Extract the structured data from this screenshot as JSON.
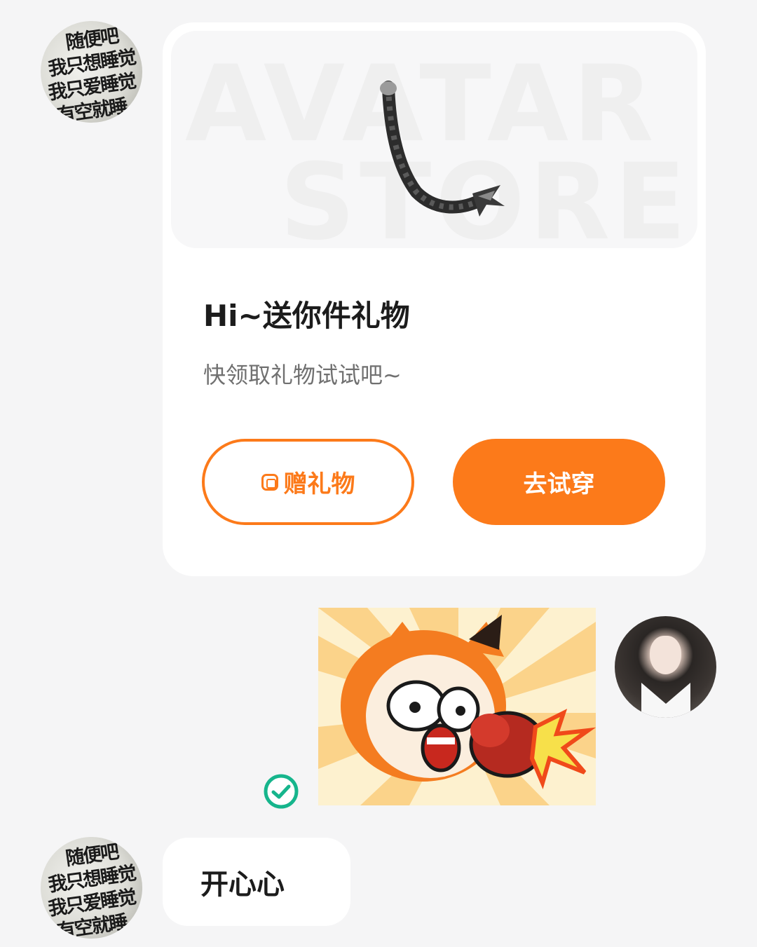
{
  "chat": {
    "gift_card": {
      "banner_background_text_line1": "AVATAR",
      "banner_background_text_line2": "STORE",
      "banner_item": "tail-accessory",
      "title": "Hi~送你件礼物",
      "subtitle": "快领取礼物试试吧~",
      "gift_button_icon": "gift-icon",
      "gift_button_label": "赠礼物",
      "try_button_label": "去试穿"
    },
    "sent_sticker": {
      "description": "orange-haired character punched by boxing glove",
      "status_icon": "check-circle-icon"
    },
    "received_text": "开心心",
    "other_avatar_text": [
      "随便吧",
      "我只想睡觉",
      "我只爱睡觉",
      "有空就睡"
    ]
  },
  "colors": {
    "accent": "#fc7a1a",
    "background": "#f5f5f6",
    "card": "#ffffff",
    "check": "#16b58c"
  }
}
